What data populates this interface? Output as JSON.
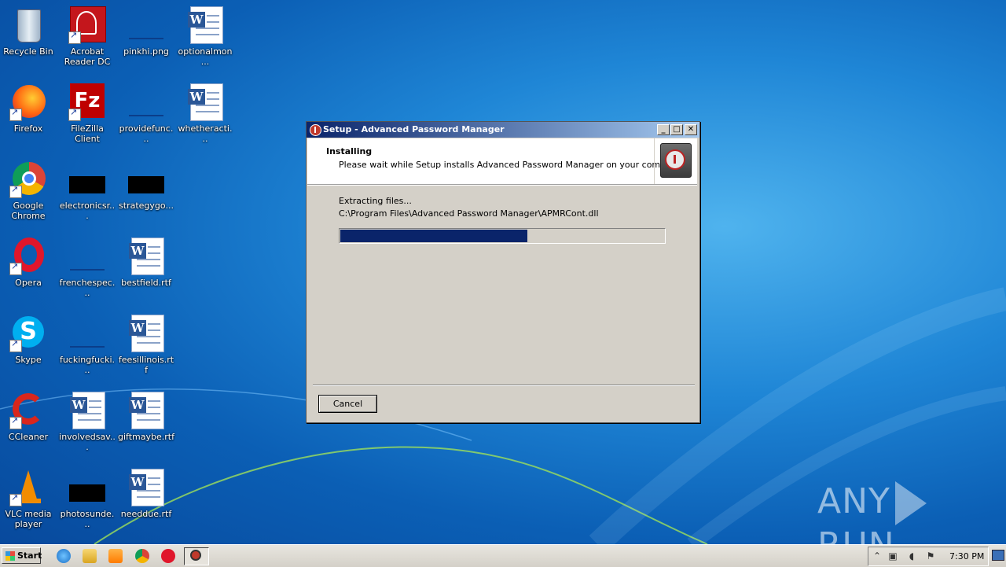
{
  "desktop": {
    "icons": [
      {
        "name": "recycle-bin",
        "label": "Recycle Bin"
      },
      {
        "name": "acrobat-reader",
        "label": "Acrobat Reader DC"
      },
      {
        "name": "pinkhi-png",
        "label": "pinkhi.png"
      },
      {
        "name": "optionalmon",
        "label": "optionalmon..."
      },
      {
        "name": "firefox",
        "label": "Firefox"
      },
      {
        "name": "filezilla",
        "label": "FileZilla Client"
      },
      {
        "name": "providefunc",
        "label": "providefunc..."
      },
      {
        "name": "whetheracti",
        "label": "whetheracti..."
      },
      {
        "name": "google-chrome",
        "label": "Google Chrome"
      },
      {
        "name": "electronicsr",
        "label": "electronicsr..."
      },
      {
        "name": "strategygo",
        "label": "strategygo..."
      },
      {
        "name": "opera",
        "label": "Opera"
      },
      {
        "name": "frenchespec",
        "label": "frenchespec..."
      },
      {
        "name": "bestfield",
        "label": "bestfield.rtf"
      },
      {
        "name": "skype",
        "label": "Skype"
      },
      {
        "name": "fuckingfucki",
        "label": "fuckingfucki..."
      },
      {
        "name": "feesillinois",
        "label": "feesillinois.rtf"
      },
      {
        "name": "ccleaner",
        "label": "CCleaner"
      },
      {
        "name": "involvedsav",
        "label": "involvedsav..."
      },
      {
        "name": "giftmaybe",
        "label": "giftmaybe.rtf"
      },
      {
        "name": "vlc",
        "label": "VLC media player"
      },
      {
        "name": "photosunde",
        "label": "photosunde..."
      },
      {
        "name": "needdue",
        "label": "needdue.rtf"
      }
    ]
  },
  "dialog": {
    "title": "Setup - Advanced Password Manager",
    "header_title": "Installing",
    "header_subtitle": "Please wait while Setup installs Advanced Password Manager on your computer.",
    "status_line": "Extracting files...",
    "current_file": "C:\\Program Files\\Advanced Password Manager\\APMRCont.dll",
    "progress_percent": 58,
    "cancel_label": "Cancel",
    "minimize_label": "_",
    "maximize_label": "□",
    "close_label": "✕"
  },
  "watermark": {
    "left": "ANY",
    "right": "RUN"
  },
  "taskbar": {
    "start_label": "Start",
    "clock": "7:30 PM",
    "tray_expand": "⌃",
    "tray_network": "▣",
    "tray_volume": "◖",
    "tray_flag": "⚑"
  }
}
